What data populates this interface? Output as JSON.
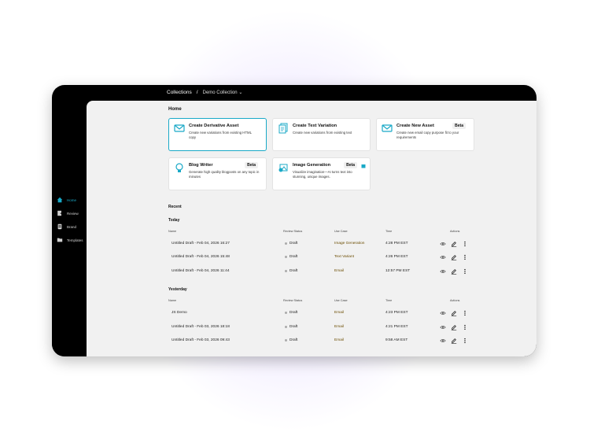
{
  "breadcrumb": {
    "root": "Collections",
    "sep": "/",
    "current": "Demo Collection",
    "caret": "⌄"
  },
  "sidebar": {
    "items": [
      {
        "label": "Home",
        "icon": "home-icon",
        "active": true
      },
      {
        "label": "Review",
        "icon": "review-icon"
      },
      {
        "label": "Brand",
        "icon": "brand-icon"
      },
      {
        "label": "Templates",
        "icon": "folder-icon"
      }
    ]
  },
  "home": {
    "title": "Home",
    "cards": [
      {
        "title": "Create Derivative Asset",
        "desc": "Create new variations from existing HTML copy"
      },
      {
        "title": "Create Text Variation",
        "desc": "Create new variations from existing text"
      },
      {
        "title": "Create New Asset",
        "desc": "Create new email copy purpose fit to your requirements",
        "badge": "Beta"
      },
      {
        "title": "Blog Writer",
        "desc": "Generate high quality blogposts on any topic in minutes",
        "badge": "Beta"
      },
      {
        "title": "Image Generation",
        "desc": "Visualize imagination—AI turns text into stunning, unique images.",
        "badge": "Beta"
      }
    ]
  },
  "recent": {
    "title": "Recent",
    "headers": {
      "name": "Name",
      "status": "Review Status",
      "usecase": "Use Case",
      "time": "Time",
      "actions": "Actions"
    },
    "today": {
      "label": "Today",
      "rows": [
        {
          "name": "Untitled Draft - Feb 04, 2026 16:27",
          "status": "Draft",
          "usecase": "Image Generation",
          "time": "4:28 PM EST"
        },
        {
          "name": "Untitled Draft - Feb 04, 2026 15:48",
          "status": "Draft",
          "usecase": "Text Variant",
          "time": "4:26 PM EST"
        },
        {
          "name": "Untitled Draft - Feb 04, 2026 11:44",
          "status": "Draft",
          "usecase": "Email",
          "time": "12:57 PM EST"
        }
      ]
    },
    "yesterday": {
      "label": "Yesterday",
      "rows": [
        {
          "name": "JS Demo",
          "status": "Draft",
          "usecase": "Email",
          "time": "4:23 PM EST"
        },
        {
          "name": "Untitled Draft - Feb 03, 2026 18:18",
          "status": "Draft",
          "usecase": "Email",
          "time": "4:21 PM EST"
        },
        {
          "name": "Untitled Draft - Feb 03, 2026 09:43",
          "status": "Draft",
          "usecase": "Email",
          "time": "9:58 AM EST"
        }
      ]
    }
  },
  "colors": {
    "accent": "#19a9c7",
    "frame": "#000000",
    "main_bg": "#f1f1f1"
  }
}
